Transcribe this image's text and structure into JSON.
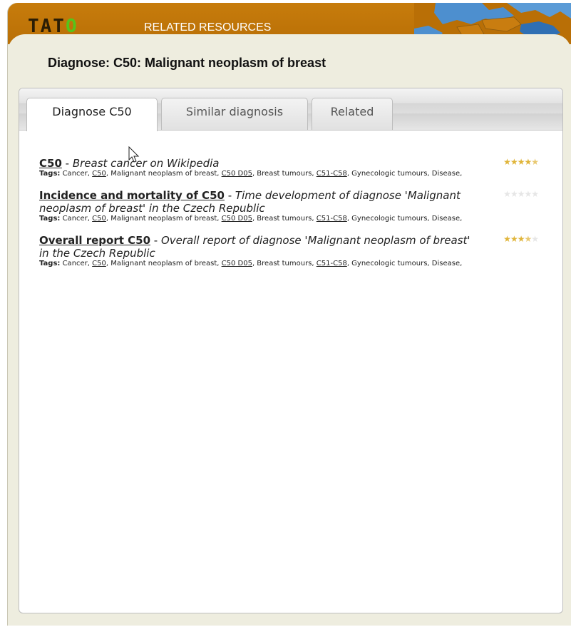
{
  "header": {
    "logo_text": "TAT",
    "logo_o": "O",
    "title": "RELATED RESOURCES"
  },
  "page": {
    "title": "Diagnose: C50: Malignant neoplasm of breast"
  },
  "tabs": [
    {
      "label": "Diagnose C50",
      "active": true
    },
    {
      "label": "Similar diagnosis",
      "active": false
    },
    {
      "label": "Related",
      "active": false
    }
  ],
  "entries": [
    {
      "link": "C50",
      "separator": " - ",
      "description": "Breast cancer on Wikipedia",
      "tags_label": "Tags:",
      "tags": [
        {
          "text": "Cancer",
          "link": false
        },
        {
          "text": "C50",
          "link": true
        },
        {
          "text": "Malignant neoplasm of breast",
          "link": false
        },
        {
          "text": "C50 D05",
          "link": true
        },
        {
          "text": "Breast tumours",
          "link": false
        },
        {
          "text": "C51-C58",
          "link": true
        },
        {
          "text": "Gynecologic tumours",
          "link": false
        },
        {
          "text": "Disease",
          "link": false
        }
      ],
      "rating": 4.5
    },
    {
      "link": "Incidence and mortality of C50",
      "separator": " - ",
      "description": "Time development of diagnose 'Malignant neoplasm of breast' in the Czech Republic",
      "tags_label": "Tags:",
      "tags": [
        {
          "text": "Cancer",
          "link": false
        },
        {
          "text": "C50",
          "link": true
        },
        {
          "text": "Malignant neoplasm of breast",
          "link": false
        },
        {
          "text": "C50 D05",
          "link": true
        },
        {
          "text": "Breast tumours",
          "link": false
        },
        {
          "text": "C51-C58",
          "link": true
        },
        {
          "text": "Gynecologic tumours",
          "link": false
        },
        {
          "text": "Disease",
          "link": false
        }
      ],
      "rating": 0
    },
    {
      "link": "Overall report C50",
      "separator": " - ",
      "description": "Overall report of diagnose 'Malignant neoplasm of breast' in the Czech Republic",
      "tags_label": "Tags:",
      "tags": [
        {
          "text": "Cancer",
          "link": false
        },
        {
          "text": "C50",
          "link": true
        },
        {
          "text": "Malignant neoplasm of breast",
          "link": false
        },
        {
          "text": "C50 D05",
          "link": true
        },
        {
          "text": "Breast tumours",
          "link": false
        },
        {
          "text": "C51-C58",
          "link": true
        },
        {
          "text": "Gynecologic tumours",
          "link": false
        },
        {
          "text": "Disease",
          "link": false
        }
      ],
      "rating": 3.5
    }
  ],
  "colors": {
    "header_orange": "#c0750a",
    "background_cream": "#eeeddf",
    "star_filled": "#e0b53a",
    "logo_green": "#56c41a"
  }
}
